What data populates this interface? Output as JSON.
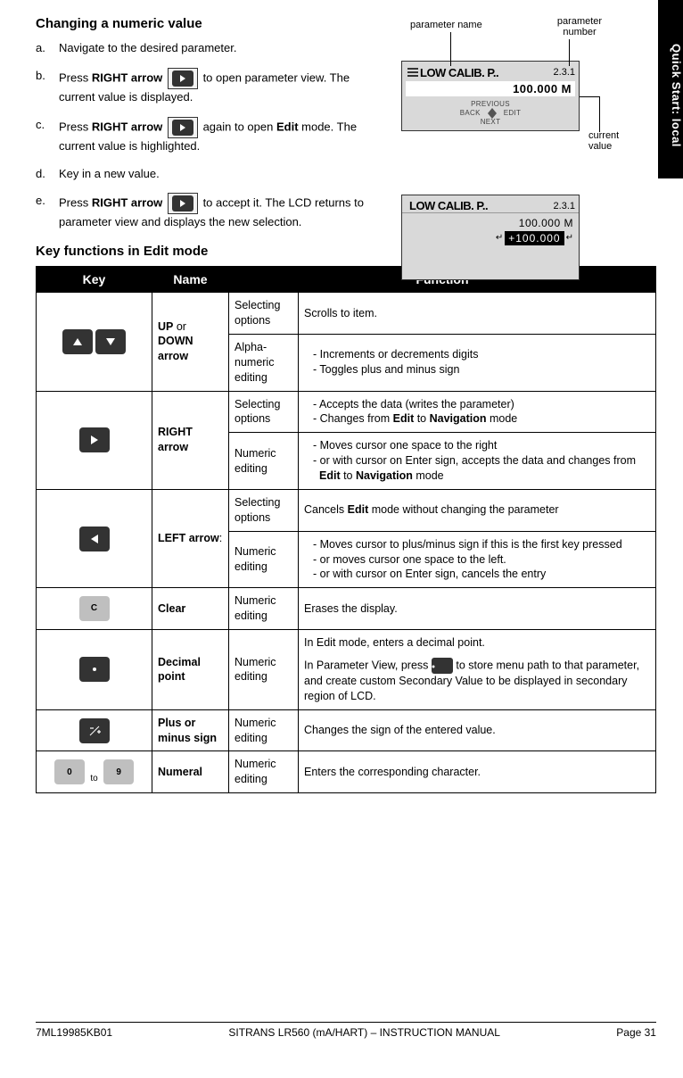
{
  "sideTab": "Quick Start: local",
  "heading1": "Changing a numeric value",
  "steps": {
    "a": {
      "m": "a.",
      "t": "Navigate to the desired parameter."
    },
    "b": {
      "m": "b.",
      "t1": "Press ",
      "bold1": "RIGHT arrow",
      "t2": " to open parameter view. The current value is displayed."
    },
    "c": {
      "m": "c.",
      "t1": "Press ",
      "bold1": "RIGHT arrow",
      "t2": " again to open ",
      "bold2": "Edit",
      "t3": " mode. The current value is highlighted."
    },
    "d": {
      "m": "d.",
      "t": "Key in a new value."
    },
    "e": {
      "m": "e.",
      "t1": "Press ",
      "bold1": "RIGHT arrow",
      "t2": " to accept it. The LCD returns to parameter view and displays the new selection."
    }
  },
  "annotations": {
    "paramName": "parameter name",
    "paramNumber": "parameter number",
    "currentValue": "current value"
  },
  "lcd1": {
    "title": "LOW CALIB. P..",
    "num": "2.3.1",
    "value": "100.000 M",
    "prev": "PREVIOUS",
    "back": "BACK",
    "edit": "EDIT",
    "next": "NEXT"
  },
  "lcd2": {
    "title": "LOW CALIB. P..",
    "num": "2.3.1",
    "value1": "100.000  M",
    "value2": "+100.000"
  },
  "heading2": "Key functions in Edit mode",
  "table": {
    "headers": {
      "key": "Key",
      "name": "Name",
      "function": "Function"
    },
    "rows": {
      "updown": {
        "name1": "UP",
        "nameOr": " or ",
        "name2": "DOWN arrow",
        "mode1": "Selecting options",
        "fn1": "Scrolls to item.",
        "mode2": "Alpha-numeric editing",
        "fn2a": "Increments or decrements digits",
        "fn2b": "Toggles plus and minus sign"
      },
      "right": {
        "name": "RIGHT arrow",
        "mode1": "Selecting options",
        "fn1a": "Accepts the data (writes the parameter)",
        "fn1b_pre": "Changes from ",
        "fn1b_b1": "Edit",
        "fn1b_mid": " to ",
        "fn1b_b2": "Navigation",
        "fn1b_post": " mode",
        "mode2": "Numeric editing",
        "fn2a": "Moves cursor one space to the right",
        "fn2b_pre": "or with cursor on Enter sign, accepts the data and changes from ",
        "fn2b_b1": "Edit",
        "fn2b_mid": " to ",
        "fn2b_b2": "Navigation",
        "fn2b_post": " mode"
      },
      "left": {
        "name": "LEFT arrow",
        "nameSuffix": ":",
        "mode1": "Selecting options",
        "fn1_pre": "Cancels ",
        "fn1_b": "Edit",
        "fn1_post": " mode without changing the parameter",
        "mode2": "Numeric editing",
        "fn2a": "Moves cursor to plus/minus sign if this is the first key pressed",
        "fn2b": "or moves cursor one space to the left.",
        "fn2c": "or with cursor on Enter sign, cancels the entry"
      },
      "clear": {
        "name": "Clear",
        "mode": "Numeric editing",
        "fn": " Erases the display."
      },
      "decimal": {
        "name": "Decimal point",
        "mode": "Numeric editing",
        "fn1": "In Edit mode, enters a decimal point.",
        "fn2_pre": "In Parameter View, press ",
        "fn2_post": " to store menu path to that parameter, and create custom Secondary Value to be displayed in secondary region of LCD."
      },
      "plusminus": {
        "name": "Plus or minus sign",
        "mode": "Numeric editing",
        "fn": "Changes the sign of the entered value."
      },
      "numeral": {
        "name": "Numeral",
        "mode": "Numeric editing",
        "fn": "Enters the corresponding character.",
        "zero": "0",
        "nine": "9",
        "to": "to"
      }
    }
  },
  "footer": {
    "left": "7ML19985KB01",
    "center": "SITRANS LR560 (mA/HART) – INSTRUCTION MANUAL",
    "right": "Page 31"
  },
  "keys": {
    "clearLetter": "C"
  }
}
